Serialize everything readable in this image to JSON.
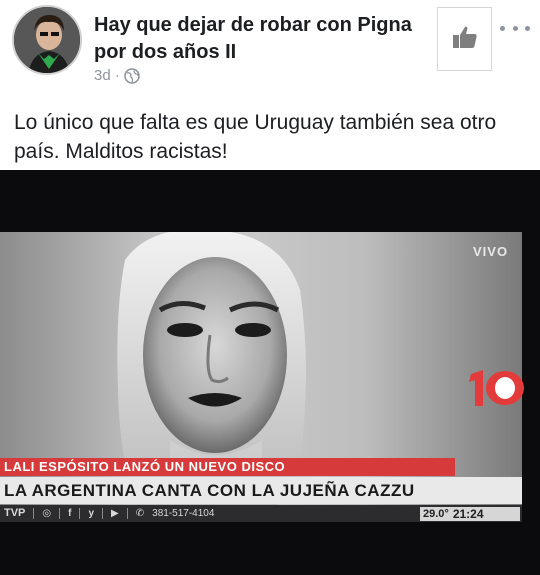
{
  "post": {
    "group_title": "Hay que dejar de robar con Pigna por dos años II",
    "time_ago": "3d",
    "separator": "·",
    "privacy_icon": "globe-icon",
    "like_icon": "thumbs-up-icon",
    "more_icon": "more-options-icon",
    "text": "Lo único que falta es que Uruguay también sea otro país. Malditos racistas!"
  },
  "photo": {
    "channel_logo_text": "10",
    "live_label": "VIVO",
    "lower_third_top": "LALI ESPÓSITO LANZÓ UN NUEVO DISCO",
    "lower_third_main": "LA ARGENTINA CANTA CON LA JUJEÑA CAZZU",
    "ticker": {
      "brand": "TVP",
      "phone": "381-517-4104",
      "temperature": "29.0°",
      "time": "21:24"
    }
  },
  "colors": {
    "lower_third_red": "#d63a3a",
    "lower_third_grey": "#e9e9e9",
    "meta_grey": "#8d949e",
    "text_dark": "#1c1e21"
  }
}
